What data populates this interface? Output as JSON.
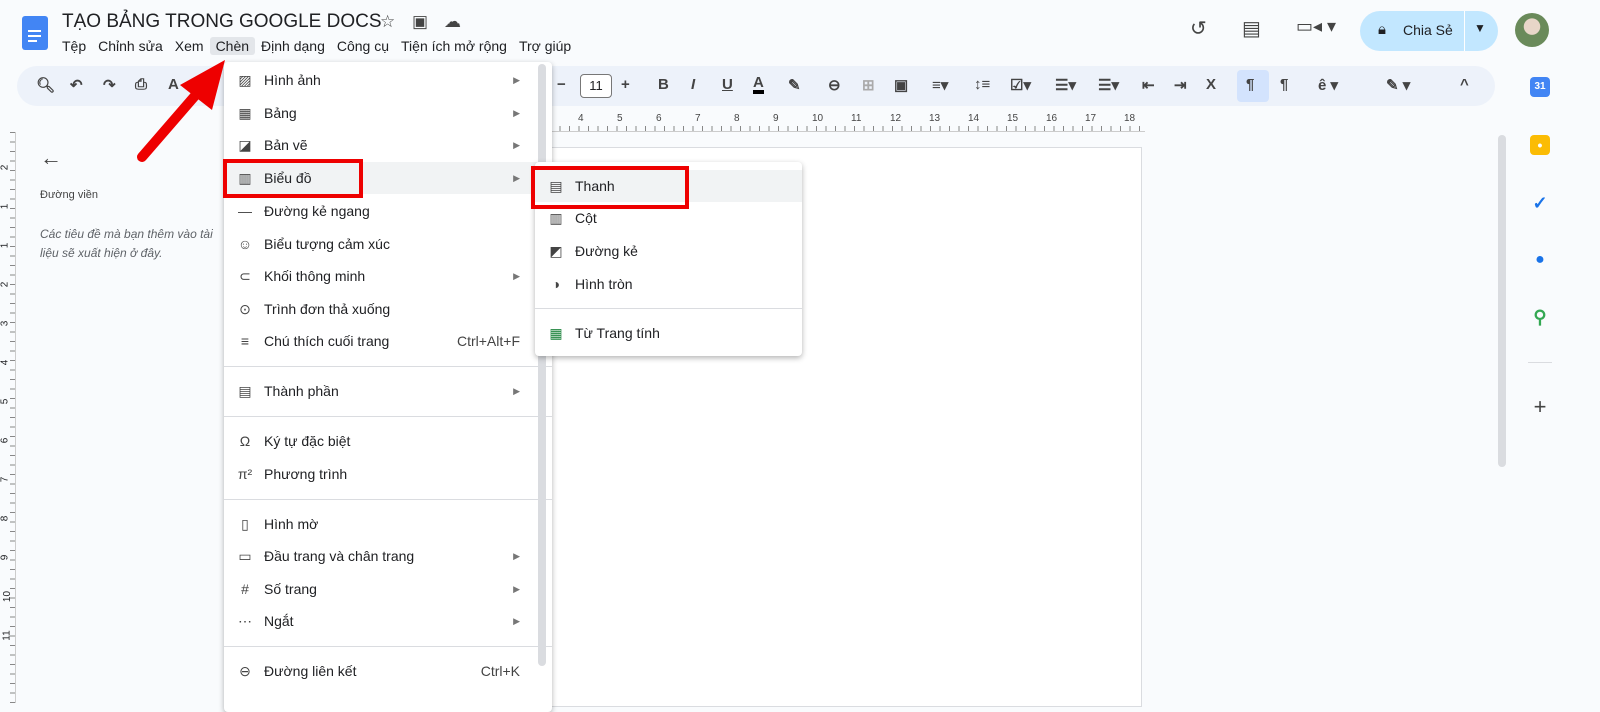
{
  "title": "TẠO BẢNG TRONG GOOGLE DOCS",
  "menubar": [
    "Tệp",
    "Chỉnh sửa",
    "Xem",
    "Chèn",
    "Định dạng",
    "Công cụ",
    "Tiện ích mở rộng",
    "Trợ giúp"
  ],
  "toolbar": {
    "font_size": "11"
  },
  "ruler": [
    "4",
    "5",
    "6",
    "7",
    "8",
    "9",
    "10",
    "11",
    "12",
    "13",
    "14",
    "15",
    "16",
    "17",
    "18"
  ],
  "vruler": [
    "2",
    "1",
    "1",
    "2",
    "3",
    "4",
    "5",
    "6",
    "7",
    "8",
    "9",
    "10",
    "11"
  ],
  "share": {
    "label": "Chia Sẻ"
  },
  "outline": {
    "title": "Đường viền",
    "hint": "Các tiêu đề mà bạn thêm vào tài liệu sẽ xuất hiện ở đây."
  },
  "insert_menu": [
    {
      "label": "Hình ảnh",
      "icon": "image-icon",
      "sub": true
    },
    {
      "label": "Bảng",
      "icon": "table-icon",
      "sub": true
    },
    {
      "label": "Bản vẽ",
      "icon": "drawing-icon",
      "sub": true
    },
    {
      "label": "Biểu đồ",
      "icon": "chart-icon",
      "sub": true
    },
    {
      "label": "Đường kẻ ngang",
      "icon": "horizontal-line-icon"
    },
    {
      "label": "Biểu tượng cảm xúc",
      "icon": "emoji-icon"
    },
    {
      "label": "Khối thông minh",
      "icon": "smart-chip-icon",
      "sub": true
    },
    {
      "label": "Trình đơn thả xuống",
      "icon": "dropdown-icon"
    },
    {
      "label": "Chú thích cuối trang",
      "icon": "footnote-icon",
      "shortcut": "Ctrl+Alt+F"
    },
    {
      "label": "Thành phần",
      "icon": "building-blocks-icon",
      "sub": true
    },
    {
      "label": "Ký tự đặc biệt",
      "icon": "omega-icon"
    },
    {
      "label": "Phương trình",
      "icon": "pi-icon"
    },
    {
      "label": "Hình mờ",
      "icon": "watermark-icon"
    },
    {
      "label": "Đầu trang và chân trang",
      "icon": "header-footer-icon",
      "sub": true
    },
    {
      "label": "Số trang",
      "icon": "hash-icon",
      "sub": true
    },
    {
      "label": "Ngắt",
      "icon": "break-icon",
      "sub": true
    },
    {
      "label": "Đường liên kết",
      "icon": "link-icon",
      "shortcut": "Ctrl+K"
    }
  ],
  "chart_menu": [
    {
      "label": "Thanh",
      "icon": "bar-chart-icon"
    },
    {
      "label": "Cột",
      "icon": "column-chart-icon"
    },
    {
      "label": "Đường kẻ",
      "icon": "line-chart-icon"
    },
    {
      "label": "Hình tròn",
      "icon": "pie-chart-icon"
    },
    {
      "label": "Từ Trang tính",
      "icon": "sheets-icon"
    }
  ],
  "colors": {
    "accent": "#c2e7ff",
    "highlight": "#e00000"
  }
}
